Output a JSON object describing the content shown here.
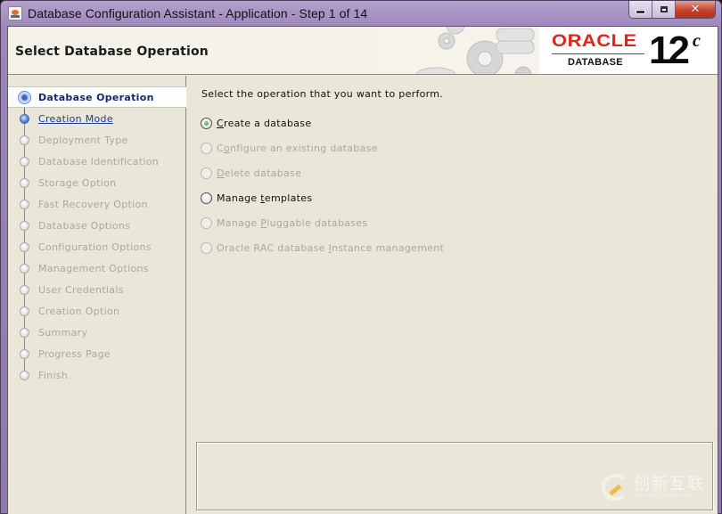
{
  "window": {
    "title": "Database Configuration Assistant - Application - Step 1 of 14",
    "controls": {
      "minimize": "minimize",
      "maximize": "maximize",
      "close": "✕"
    }
  },
  "header": {
    "title": "Select Database Operation",
    "brand": {
      "name": "ORACLE",
      "registered": "®",
      "product": "DATABASE",
      "version": "12",
      "version_suffix": "c"
    }
  },
  "steps": [
    {
      "label": "Database Operation",
      "state": "current"
    },
    {
      "label": "Creation Mode",
      "state": "link"
    },
    {
      "label": "Deployment Type",
      "state": "disabled"
    },
    {
      "label": "Database Identification",
      "state": "disabled"
    },
    {
      "label": "Storage Option",
      "state": "disabled"
    },
    {
      "label": "Fast Recovery Option",
      "state": "disabled"
    },
    {
      "label": "Database Options",
      "state": "disabled"
    },
    {
      "label": "Configuration Options",
      "state": "disabled"
    },
    {
      "label": "Management Options",
      "state": "disabled"
    },
    {
      "label": "User Credentials",
      "state": "disabled"
    },
    {
      "label": "Creation Option",
      "state": "disabled"
    },
    {
      "label": "Summary",
      "state": "disabled"
    },
    {
      "label": "Progress Page",
      "state": "disabled"
    },
    {
      "label": "Finish",
      "state": "disabled"
    }
  ],
  "content": {
    "prompt": "Select the operation that you want to perform.",
    "options": [
      {
        "label": "Create a database",
        "mnemonic_index": 0,
        "checked": true,
        "enabled": true
      },
      {
        "label": "Configure an existing database",
        "mnemonic_index": 1,
        "checked": false,
        "enabled": false
      },
      {
        "label": "Delete database",
        "mnemonic_index": 0,
        "checked": false,
        "enabled": false
      },
      {
        "label": "Manage templates",
        "mnemonic_index": 7,
        "checked": false,
        "enabled": true
      },
      {
        "label": "Manage Pluggable databases",
        "mnemonic_index": 7,
        "checked": false,
        "enabled": false
      },
      {
        "label": "Oracle RAC database Instance management",
        "mnemonic_index": 20,
        "checked": false,
        "enabled": false
      }
    ]
  },
  "watermark": {
    "cn": "创新互联",
    "en": "CHUANG XIN HU LIAN"
  },
  "colors": {
    "oracle_red": "#e2231a",
    "current_step": "#0f2a6e",
    "link_step": "#1b3a9a",
    "disabled_text": "#a8a8a0",
    "panel_bg": "#ebe7d8"
  }
}
